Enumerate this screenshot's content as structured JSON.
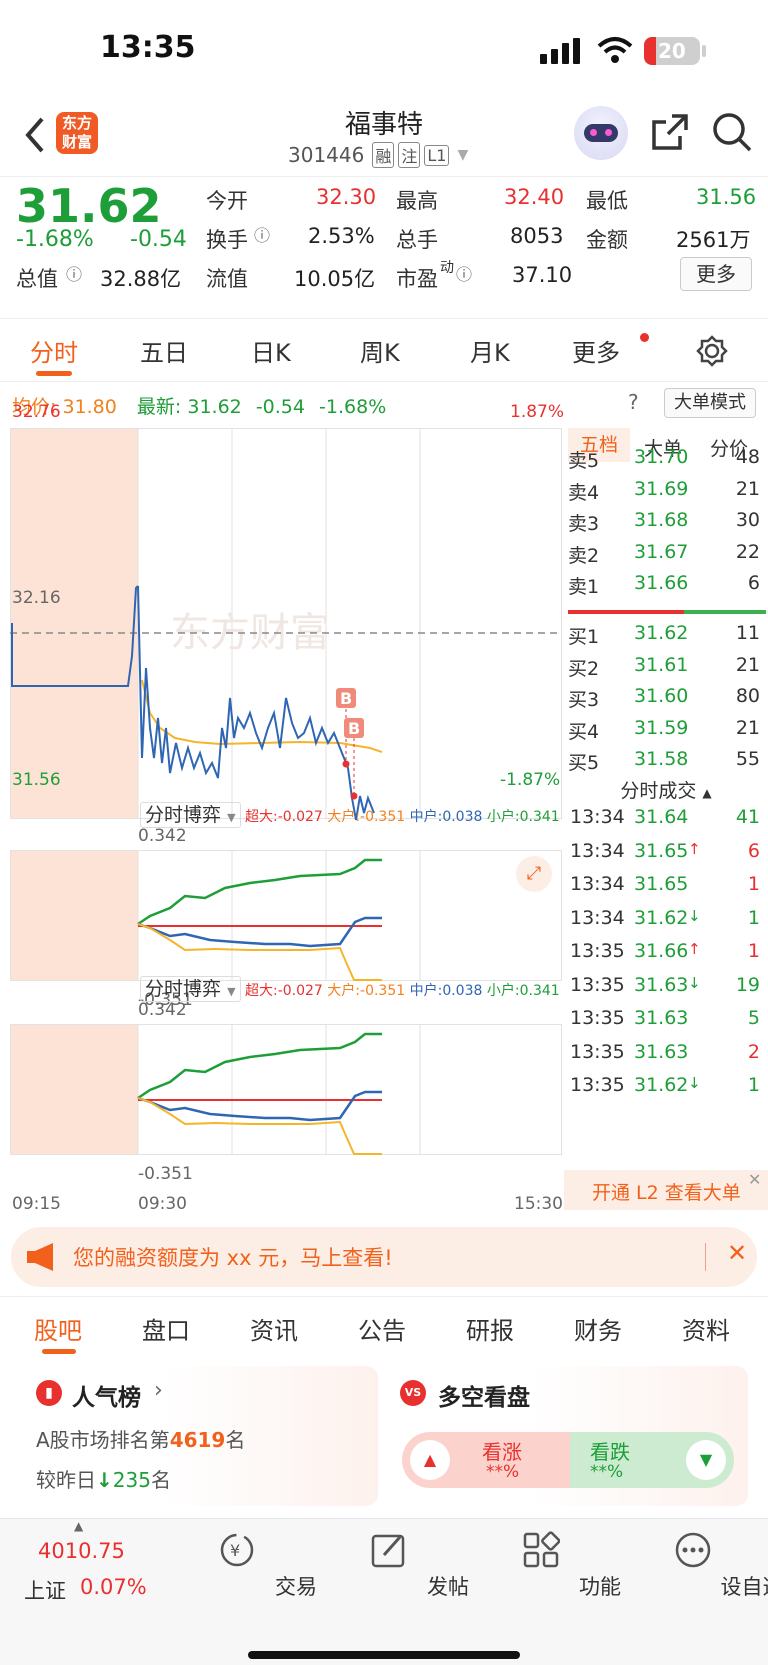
{
  "status": {
    "time": "13:35",
    "battery": "20"
  },
  "header": {
    "title": "福事特",
    "code": "301446",
    "tags": [
      "融",
      "注",
      "L1"
    ],
    "logo": "东方\n财富"
  },
  "quote": {
    "price": "31.62",
    "pct": "-1.68%",
    "chg": "-0.54",
    "items": {
      "open_label": "今开",
      "open": "32.30",
      "high_label": "最高",
      "high": "32.40",
      "low_label": "最低",
      "low": "31.56",
      "turnover_label": "换手",
      "turnover": "2.53%",
      "vol_label": "总手",
      "vol": "8053",
      "amount_label": "金额",
      "amount": "2561万",
      "mcap_label": "总值",
      "mcap": "32.88亿",
      "float_label": "流值",
      "float": "10.05亿",
      "pe_label": "市盈",
      "pe_sup": "动",
      "pe": "37.10",
      "more_btn": "更多"
    }
  },
  "tabs": [
    "分时",
    "五日",
    "日K",
    "周K",
    "月K",
    "更多"
  ],
  "info_line": {
    "avg_label": "均价:",
    "avg": "31.80",
    "last_label": "最新:",
    "last": "31.62",
    "chg": "-0.54",
    "pct": "-1.68%",
    "mode_btn": "大单模式"
  },
  "main_chart": {
    "y_max": "32.76",
    "y_mid": "32.16",
    "y_min": "31.56",
    "pct_max": "1.87%",
    "pct_min": "-1.87%",
    "watermark": "东方财富",
    "marker": "B"
  },
  "sub_chart": {
    "title": "分时博弈",
    "chaoda_label": "超大:",
    "chaoda": "-0.027",
    "dahu_label": "大户:",
    "dahu": "-0.351",
    "zhonghu_label": "中户:",
    "zhonghu": "0.038",
    "xiaohu_label": "小户:",
    "xiaohu": "0.341",
    "y_max": "0.342",
    "y_min": "-0.351"
  },
  "time_axis": [
    "09:15",
    "09:30",
    "15:30"
  ],
  "book_tabs": [
    "五档",
    "大单",
    "分价"
  ],
  "asks": [
    {
      "label": "卖5",
      "price": "31.70",
      "vol": "48"
    },
    {
      "label": "卖4",
      "price": "31.69",
      "vol": "21"
    },
    {
      "label": "卖3",
      "price": "31.68",
      "vol": "30"
    },
    {
      "label": "卖2",
      "price": "31.67",
      "vol": "22"
    },
    {
      "label": "卖1",
      "price": "31.66",
      "vol": "6"
    }
  ],
  "bids": [
    {
      "label": "买1",
      "price": "31.62",
      "vol": "11"
    },
    {
      "label": "买2",
      "price": "31.61",
      "vol": "21"
    },
    {
      "label": "买3",
      "price": "31.60",
      "vol": "80"
    },
    {
      "label": "买4",
      "price": "31.59",
      "vol": "21"
    },
    {
      "label": "买5",
      "price": "31.58",
      "vol": "55"
    }
  ],
  "trades_title": "分时成交",
  "trades": [
    {
      "time": "13:34",
      "price": "31.64",
      "dir": "",
      "vol": "41",
      "pc": "green",
      "vc": "green"
    },
    {
      "time": "13:34",
      "price": "31.65",
      "dir": "↑",
      "vol": "6",
      "pc": "green",
      "vc": "red"
    },
    {
      "time": "13:34",
      "price": "31.65",
      "dir": "",
      "vol": "1",
      "pc": "green",
      "vc": "red"
    },
    {
      "time": "13:34",
      "price": "31.62",
      "dir": "↓",
      "vol": "1",
      "pc": "green",
      "vc": "green"
    },
    {
      "time": "13:35",
      "price": "31.66",
      "dir": "↑",
      "vol": "1",
      "pc": "green",
      "vc": "red"
    },
    {
      "time": "13:35",
      "price": "31.63",
      "dir": "↓",
      "vol": "19",
      "pc": "green",
      "vc": "green"
    },
    {
      "time": "13:35",
      "price": "31.63",
      "dir": "",
      "vol": "5",
      "pc": "green",
      "vc": "green"
    },
    {
      "time": "13:35",
      "price": "31.63",
      "dir": "",
      "vol": "2",
      "pc": "green",
      "vc": "red"
    },
    {
      "time": "13:35",
      "price": "31.62",
      "dir": "↓",
      "vol": "1",
      "pc": "green",
      "vc": "green"
    }
  ],
  "l2_promo": "开通 L2 查看大单",
  "banner": {
    "text": "您的融资额度为 xx 元，马上查看!"
  },
  "bottom_tabs": [
    "股吧",
    "盘口",
    "资讯",
    "公告",
    "研报",
    "财务",
    "资料"
  ],
  "popularity": {
    "title": "人气榜",
    "rank_prefix": "A股市场排名第",
    "rank": "4619",
    "rank_suffix": "名",
    "change_prefix": "较昨日",
    "change": "235",
    "change_suffix": "名"
  },
  "vote": {
    "title": "多空看盘",
    "bull_label": "看涨",
    "bull_val": "**%",
    "bear_label": "看跌",
    "bear_val": "**%",
    "vs_logo": "VS"
  },
  "nav": {
    "index_value": "4010.75",
    "index_name": "上证",
    "index_pct": "0.07%",
    "items": [
      "交易",
      "发帖",
      "功能",
      "设自选"
    ]
  },
  "colors": {
    "up": "#e8312f",
    "down": "#1e9e38",
    "accent": "#f2801c",
    "price_line": "#2f66b4",
    "avg_line": "#f5b52a"
  }
}
